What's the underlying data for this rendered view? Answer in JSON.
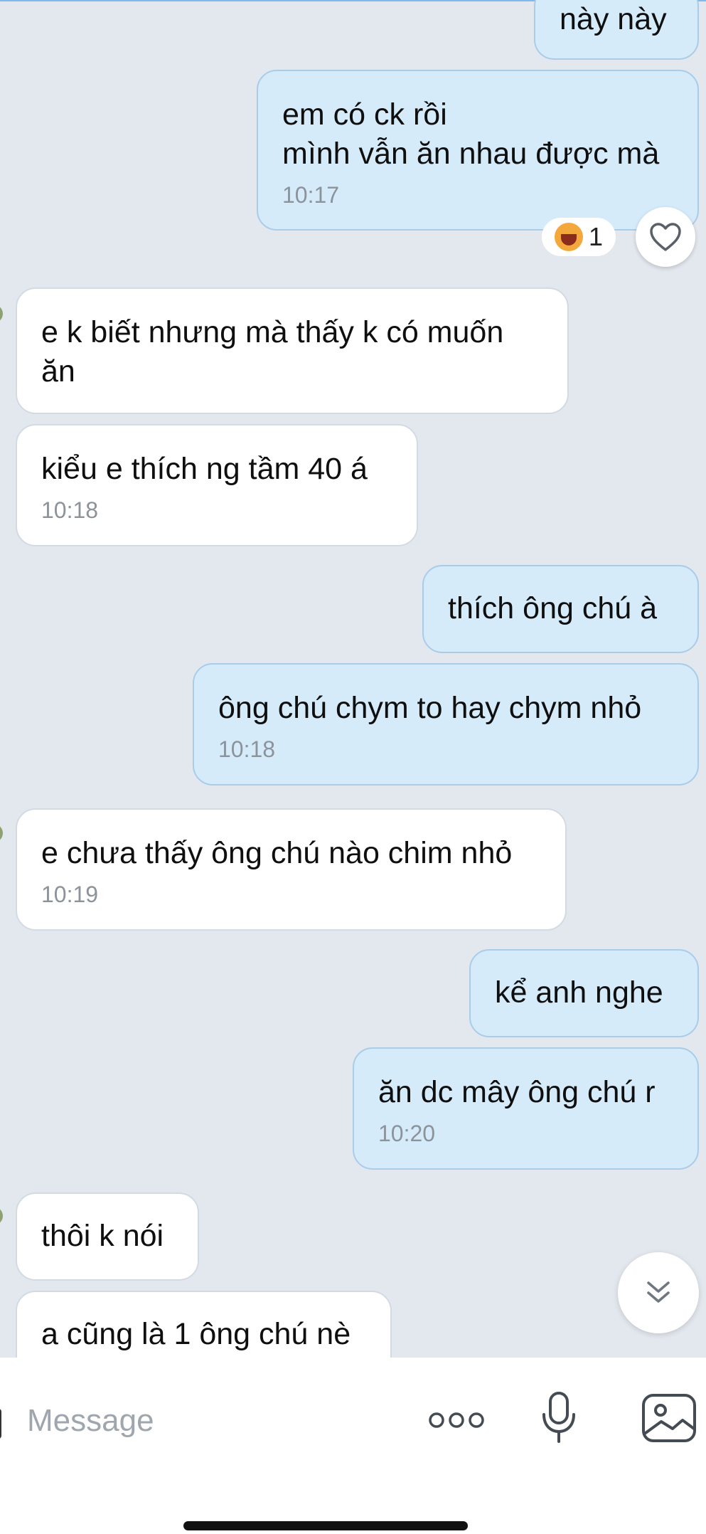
{
  "colors": {
    "background": "#e3e8ee",
    "incoming_bubble": "#ffffff",
    "outgoing_bubble": "#d5ebfa",
    "timestamp": "#8c939b",
    "icon": "#444b53"
  },
  "messages": [
    {
      "dir": "out",
      "text": "này này",
      "time": ""
    },
    {
      "dir": "out",
      "text": "em có ck rồi\nmình vẫn ăn nhau được mà",
      "time": "10:17"
    },
    {
      "dir": "in",
      "text": "e k biết nhưng mà thấy k có muốn\năn",
      "time": ""
    },
    {
      "dir": "in",
      "text": "kiểu e thích ng tầm 40 á",
      "time": "10:18"
    },
    {
      "dir": "out",
      "text": "thích ông chú à",
      "time": ""
    },
    {
      "dir": "out",
      "text": "ông chú chym to hay chym nhỏ",
      "time": "10:18"
    },
    {
      "dir": "in",
      "text": "e chưa thấy ông chú nào chim nhỏ",
      "time": "10:19"
    },
    {
      "dir": "out",
      "text": "kể anh nghe",
      "time": ""
    },
    {
      "dir": "out",
      "text": "ăn dc mây ông chú r",
      "time": "10:20"
    },
    {
      "dir": "in",
      "text": "thôi k nói",
      "time": ""
    },
    {
      "dir": "in",
      "text": "a cũng là 1 ông chú nè",
      "time": ""
    }
  ],
  "reaction": {
    "emoji": "laughing-face-icon",
    "count": "1"
  },
  "composer": {
    "placeholder": "Message",
    "icons": [
      "more-options-icon",
      "microphone-icon",
      "image-gallery-icon"
    ]
  }
}
